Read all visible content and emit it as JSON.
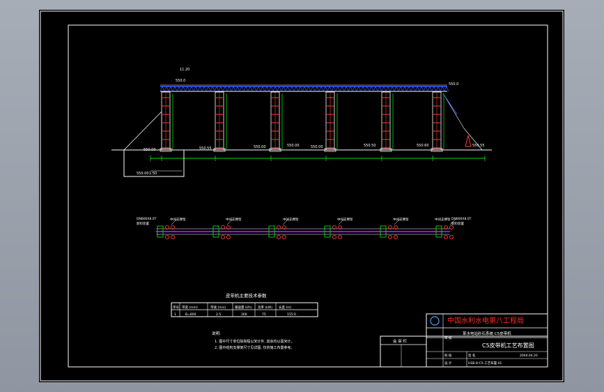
{
  "colors": {
    "frame": "#ffffff",
    "structure_red": "#ff3b3b",
    "structure_green": "#00e000",
    "truss_blue": "#3d5bff",
    "conveyor_magenta": "#b000ff",
    "title_red": "#ff2a2a",
    "viewport_bg": "#000000"
  },
  "elevation": {
    "labels": [
      "11.20",
      "550.0",
      "550.0",
      "550.00",
      "550.55",
      "550.00",
      "550.00",
      "550.50",
      "550.60",
      "550.55",
      "550.00",
      "550.00"
    ],
    "note": "1:50"
  },
  "plan": {
    "left_labels": [
      "DN800X8.0T",
      "卸料装置"
    ],
    "right_labels": [
      "DN800X8.0T",
      "卸料装置"
    ],
    "callouts": [
      "中间支撑架",
      "中间支撑架",
      "中间支撑架",
      "中间支撑架",
      "中间支撑架",
      "中间支撑架"
    ]
  },
  "spec_table": {
    "title": "皮带机主要技术参数",
    "headers": [
      "序号",
      "带宽 (mm)",
      "带速 (m/s)",
      "输送量 (t/h)",
      "功率 (kW)",
      "长度 (m)"
    ],
    "row": [
      "1",
      "B=800",
      "2.5",
      "300",
      "75",
      "155.0"
    ]
  },
  "notes": {
    "heading": "说明:",
    "items": [
      "1. 图中尺寸单位除高程以米计外, 其余均以毫米计。",
      "2. 图中结构支撑架尺寸见详图, 仅供施工布置参考。"
    ]
  },
  "title_block": {
    "company": "中国水利水电第八工程局",
    "project": "某水电站砂石系统  C5皮带机",
    "drawing_title": "C5皮带机工艺布置图",
    "approval_label": "会 审 栏",
    "role_labels": [
      "审 核",
      "校 核",
      "设 计"
    ],
    "signature": "签 名",
    "date": "2004.04.20",
    "drawing_no": "HSB-8-C5-工艺布置-01"
  }
}
